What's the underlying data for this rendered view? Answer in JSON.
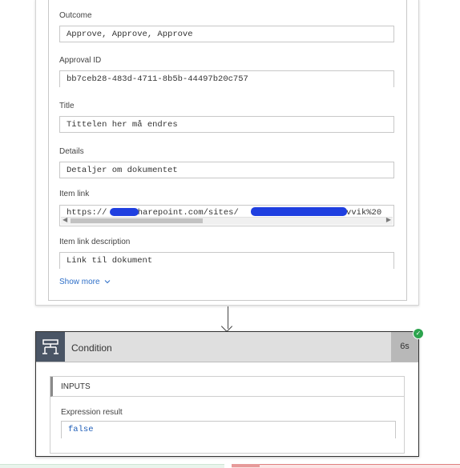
{
  "approval_card": {
    "fields": [
      {
        "label": "Outcome",
        "value": "Approve, Approve, Approve"
      },
      {
        "label": "Approval ID",
        "value": "bb7ceb28-483d-4711-8b5b-44497b20c757"
      },
      {
        "label": "Title",
        "value": "Tittelen her må endres"
      },
      {
        "label": "Details",
        "value": "Detaljer om dokumentet"
      },
      {
        "label": "Item link",
        "value_prefix": "https://",
        "value_mid": "sharepoint.com/sites/",
        "value_mid2": "Avvik%20",
        "redacted": true
      },
      {
        "label": "Item link description",
        "value": "Link til dokument"
      }
    ],
    "show_more_label": "Show more"
  },
  "condition_card": {
    "title": "Condition",
    "duration": "6s",
    "status": "succeeded",
    "inputs_title": "INPUTS",
    "expression_label": "Expression result",
    "expression_value": "false"
  },
  "icons": {
    "condition": "condition-icon",
    "status": "success-check-icon",
    "show_more": "chevron-down-icon",
    "connector": "arrow-down-icon"
  },
  "colors": {
    "link": "#2e6fc8",
    "condition_icon_bg": "#4a5565",
    "success": "#2da44e",
    "value_blue": "#1f5eb8",
    "redaction": "#1f3fe0"
  }
}
